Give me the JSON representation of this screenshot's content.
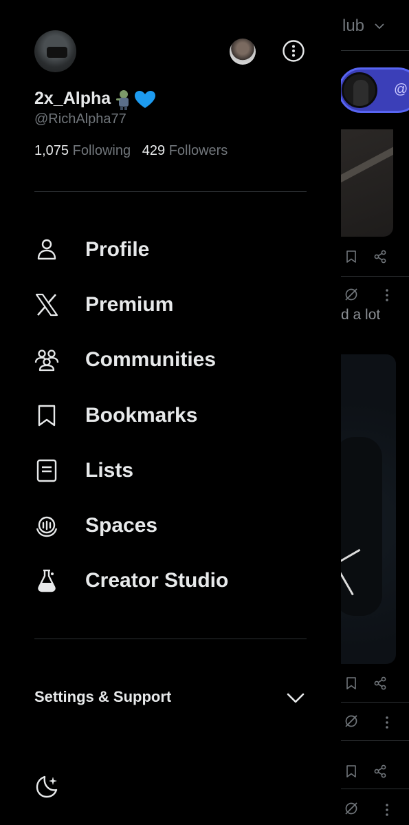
{
  "feed": {
    "header_title": "lub",
    "space_handle": "@",
    "snippet": "d a lot",
    "icons": [
      "chevron-down-icon",
      "bookmark-icon",
      "share-icon",
      "grok-icon",
      "more-icon"
    ]
  },
  "profile": {
    "display_name": "2x_Alpha",
    "emoji": [
      "zombie-emoji",
      "blue-heart-emoji"
    ],
    "handle": "@RichAlpha77",
    "following_count": "1,075",
    "following_label": "Following",
    "followers_count": "429",
    "followers_label": "Followers"
  },
  "menu": {
    "items": [
      {
        "label": "Profile",
        "icon": "person-icon"
      },
      {
        "label": "Premium",
        "icon": "x-logo-icon"
      },
      {
        "label": "Communities",
        "icon": "communities-icon"
      },
      {
        "label": "Bookmarks",
        "icon": "bookmark-icon"
      },
      {
        "label": "Lists",
        "icon": "list-icon"
      },
      {
        "label": "Spaces",
        "icon": "spaces-icon"
      },
      {
        "label": "Creator Studio",
        "icon": "flask-icon"
      }
    ]
  },
  "settings": {
    "label": "Settings & Support",
    "icon": "chevron-down-icon"
  },
  "theme": {
    "icon": "moon-star-icon"
  },
  "colors": {
    "background": "#000000",
    "text_primary": "#e7e9ea",
    "text_secondary": "#71767b",
    "divider": "#2f3336",
    "space_accent": "#5865f2",
    "heart": "#1d9bf0"
  }
}
